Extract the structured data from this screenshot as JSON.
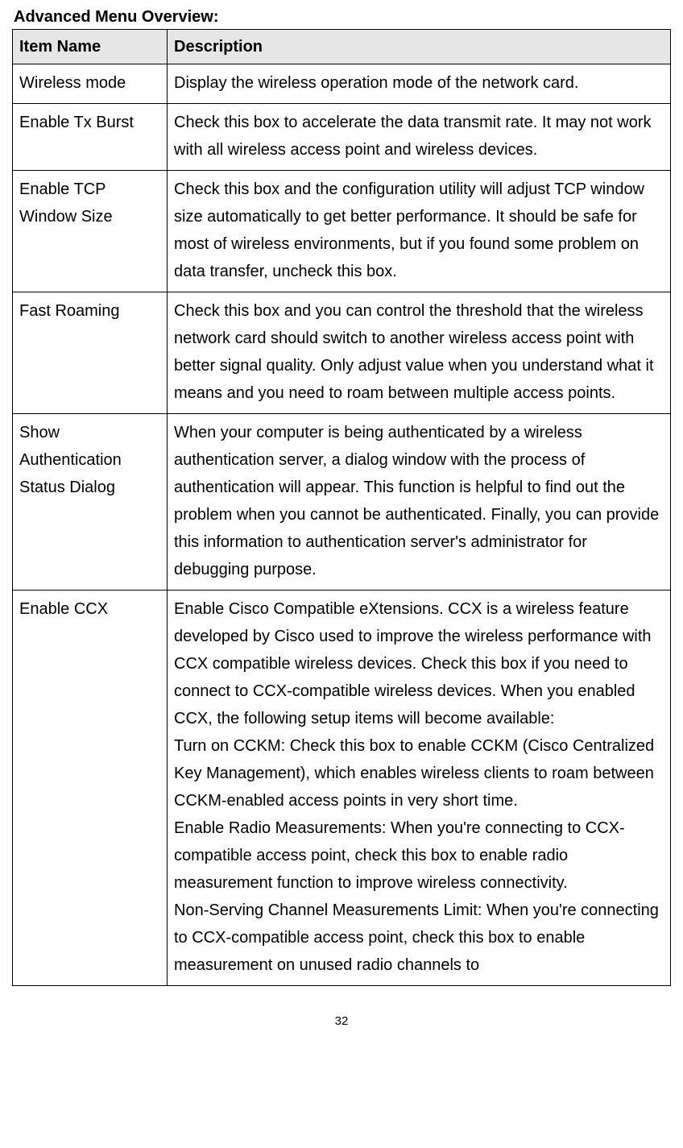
{
  "title": "Advanced Menu Overview:",
  "headers": {
    "item": "Item Name",
    "description": "Description"
  },
  "rows": [
    {
      "item": "Wireless mode",
      "description": "Display the wireless operation mode of the network card."
    },
    {
      "item": "Enable Tx Burst",
      "description": "Check this box to accelerate the data transmit rate. It may not work with all wireless access point and wireless devices."
    },
    {
      "item": "Enable TCP Window Size",
      "description": "Check this box and the configuration utility will adjust TCP window size automatically to get better performance. It should be safe for most of wireless environments, but if you found some problem on data transfer, uncheck this box."
    },
    {
      "item": "Fast Roaming",
      "description": "Check this box and you can control the threshold that the wireless network card should switch to another wireless access point with better signal quality. Only adjust value when you understand what it means and you need to roam between multiple access points."
    },
    {
      "item": "Show Authentication Status Dialog",
      "description": "When your computer is being authenticated by a wireless authentication server, a dialog window with the process of authentication will appear. This function is helpful to find out the problem when you cannot be authenticated.    Finally, you can provide this information to authentication server's administrator for debugging purpose."
    },
    {
      "item": "Enable CCX",
      "description": "Enable Cisco Compatible eXtensions. CCX is a wireless feature developed by Cisco used to improve the wireless performance with CCX compatible wireless devices. Check this box if you need to connect to CCX-compatible wireless devices. When you enabled CCX, the following setup items will become available:\nTurn on CCKM: Check this box to enable CCKM (Cisco Centralized Key Management), which enables wireless clients to roam between CCKM-enabled access points in very short time.\nEnable Radio Measurements: When you're connecting to CCX-compatible access point, check this box to enable radio measurement function to improve wireless connectivity.\nNon-Serving Channel Measurements Limit: When you're connecting to CCX-compatible access point, check this box to enable measurement on unused radio channels to"
    }
  ],
  "pageNumber": "32"
}
